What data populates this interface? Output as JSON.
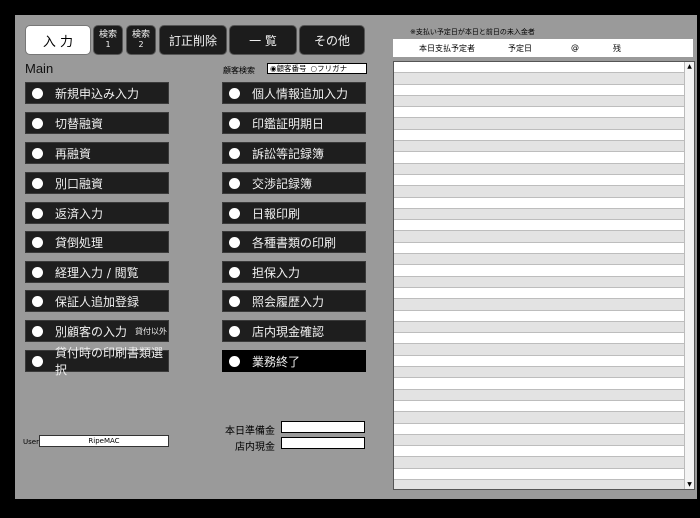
{
  "tabs": [
    {
      "label": "入 力",
      "active": true
    },
    {
      "label": "検索",
      "sub": "1"
    },
    {
      "label": "検索",
      "sub": "2"
    },
    {
      "label": "訂正削除"
    },
    {
      "label": "一 覧"
    },
    {
      "label": "その他"
    }
  ],
  "main_label": "Main",
  "left_buttons": [
    {
      "label": "新規申込み入力"
    },
    {
      "label": "切替融資"
    },
    {
      "label": "再融資"
    },
    {
      "label": "別口融資"
    },
    {
      "label": "返済入力"
    },
    {
      "label": "貸倒処理"
    },
    {
      "label": "経理入力 /  閲覧"
    },
    {
      "label": "保証人追加登録"
    },
    {
      "label": "別顧客の入力",
      "note": "貸付以外"
    },
    {
      "label": "貸付時の印刷書類選択"
    }
  ],
  "right_buttons": [
    {
      "label": "個人情報追加入力"
    },
    {
      "label": "印鑑証明期日"
    },
    {
      "label": "訴訟等記録簿"
    },
    {
      "label": "交渉記録簿"
    },
    {
      "label": "日報印刷"
    },
    {
      "label": "各種書類の印刷"
    },
    {
      "label": "担保入力"
    },
    {
      "label": "照会履歴入力"
    },
    {
      "label": "店内現金確認"
    },
    {
      "label": "業務終了"
    }
  ],
  "customer_search": {
    "label": "顧客検索",
    "options": [
      "◉顧客番号",
      "○フリガナ"
    ]
  },
  "user": {
    "label": "User",
    "value": "RipeMAC"
  },
  "cash": {
    "reserve_label": "本日準備金",
    "store_label": "店内現金"
  },
  "payments": {
    "note": "※支払い予定日が本日と前日の未入金者",
    "headers": [
      "本日支払予定者",
      "予定日",
      "@",
      "残"
    ]
  }
}
